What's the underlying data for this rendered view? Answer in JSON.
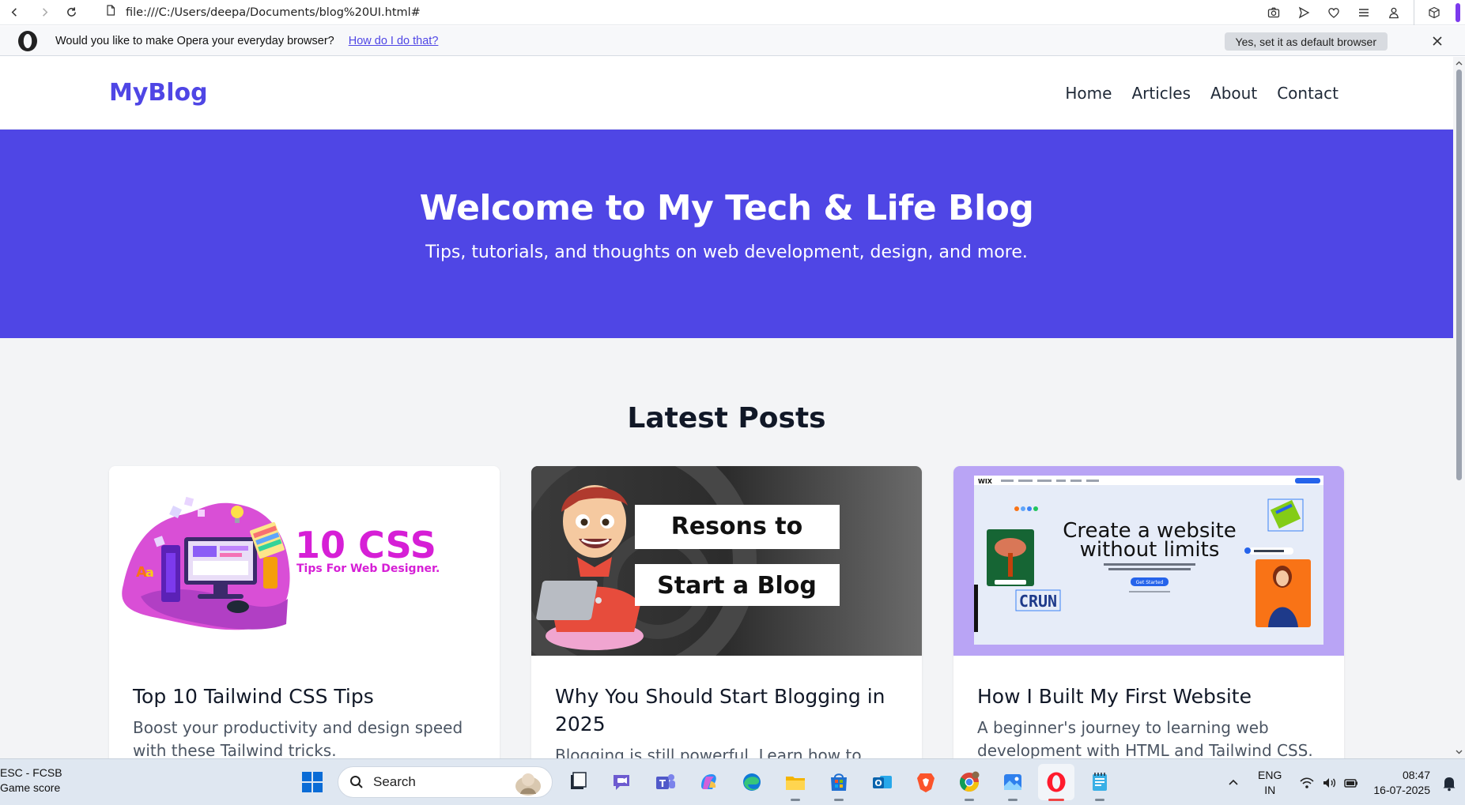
{
  "browser": {
    "url": "file:///C:/Users/deepa/Documents/blog%20UI.html#",
    "infobar": {
      "message": "Would you like to make Opera your everyday browser?",
      "link": "How do I do that?",
      "default_button": "Yes, set it as default browser"
    },
    "toolbar_icons": [
      "camera-icon",
      "send-icon",
      "heart-icon",
      "menu-icon",
      "profile-icon",
      "box-icon"
    ]
  },
  "site": {
    "logo": "MyBlog",
    "nav": [
      "Home",
      "Articles",
      "About",
      "Contact"
    ],
    "hero": {
      "title": "Welcome to My Tech & Life Blog",
      "subtitle": "Tips, tutorials, and thoughts on web development, design, and more."
    },
    "latest_heading": "Latest Posts",
    "posts": [
      {
        "title": "Top 10 Tailwind CSS Tips",
        "excerpt": "Boost your productivity and design speed with these Tailwind tricks.",
        "image": {
          "headline": "10 CSS",
          "tagline": "Tips For Web Designer."
        }
      },
      {
        "title": "Why You Should Start Blogging in 2025",
        "excerpt": "Blogging is still powerful. Learn how to build",
        "image": {
          "line1": "Resons to",
          "line2": "Start a Blog"
        }
      },
      {
        "title": "How I Built My First Website",
        "excerpt": "A beginner's journey to learning web development with HTML and Tailwind CSS.",
        "image": {
          "brand": "WIX",
          "headline_1": "Create a website",
          "headline_2": "without limits",
          "cta": "Get Started"
        }
      }
    ]
  },
  "taskbar": {
    "game": {
      "line1": "ESC - FCSB",
      "line2": "Game score"
    },
    "search_label": "Search",
    "apps": [
      "file-explorer-icon",
      "chat-icon",
      "teams-icon",
      "copilot-icon",
      "edge-icon",
      "folder-icon",
      "store-icon",
      "outlook-icon",
      "brave-icon",
      "chrome-icon",
      "photos-icon",
      "opera-icon",
      "notepad-icon"
    ],
    "language": {
      "line1": "ENG",
      "line2": "IN"
    },
    "time": "08:47",
    "date": "16-07-2025",
    "accent": "#4f46e5"
  }
}
